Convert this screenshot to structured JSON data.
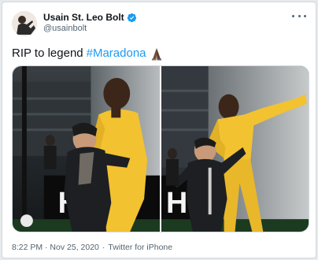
{
  "tweet": {
    "display_name": "Usain St. Leo Bolt",
    "handle": "@usainbolt",
    "text_plain": "RIP to legend",
    "hashtag": "#Maradona",
    "date": "8:22 PM · Nov 25, 2020",
    "separator": "·",
    "source": "Twitter for iPhone",
    "banner_text": "HU"
  },
  "icons": {
    "verified": "verified-badge-icon",
    "more": "more-options-icon",
    "emoji": "folded-hands-emoji"
  },
  "colors": {
    "link": "#1d9bf0",
    "verified": "#1d9bf0",
    "jersey_yellow": "#f2c230"
  }
}
